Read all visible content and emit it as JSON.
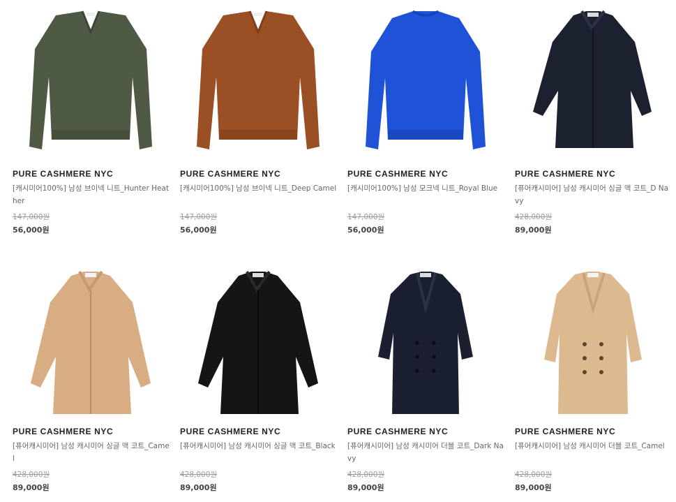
{
  "products": [
    {
      "brand": "PURE CASHMERE NYC",
      "name": "[캐시미어100%] 남성 브이넥 니트_Hunter Heather",
      "original_price": "147,000원",
      "price": "56,000원",
      "image": "vneck-sweater-icon",
      "color": "#4f5a45"
    },
    {
      "brand": "PURE CASHMERE NYC",
      "name": "[캐시미어100%] 남성 브이넥 니트_Deep Camel",
      "original_price": "147,000원",
      "price": "56,000원",
      "image": "vneck-sweater-icon",
      "color": "#9a4f24"
    },
    {
      "brand": "PURE CASHMERE NYC",
      "name": "[캐시미어100%] 남성 모크넥 니트_Royal Blue",
      "original_price": "147,000원",
      "price": "56,000원",
      "image": "mockneck-sweater-icon",
      "color": "#1f52d6"
    },
    {
      "brand": "PURE CASHMERE NYC",
      "name": "[퓨어캐시미어] 남성 캐시미어 싱글 맥 코트_D Navy",
      "original_price": "428,000원",
      "price": "89,000원",
      "image": "single-mac-coat-icon",
      "color": "#1c2130"
    },
    {
      "brand": "PURE CASHMERE NYC",
      "name": "[퓨어캐시미어] 남성 캐시미어 싱글 맥 코트_Camel",
      "original_price": "428,000원",
      "price": "89,000원",
      "image": "single-mac-coat-icon",
      "color": "#d8ad83"
    },
    {
      "brand": "PURE CASHMERE NYC",
      "name": "[퓨어캐시미어] 남성 캐시미어 싱글 맥 코트_Black",
      "original_price": "428,000원",
      "price": "89,000원",
      "image": "single-mac-coat-icon",
      "color": "#151515"
    },
    {
      "brand": "PURE CASHMERE NYC",
      "name": "[퓨어캐시미어] 남성 캐시미어 더블 코트_Dark Navy",
      "original_price": "428,000원",
      "price": "89,000원",
      "image": "double-coat-icon",
      "color": "#1b2030"
    },
    {
      "brand": "PURE CASHMERE NYC",
      "name": "[퓨어캐시미어] 남성 캐시미어 더블 코트_Camel",
      "original_price": "428,000원",
      "price": "89,000원",
      "image": "double-coat-icon",
      "color": "#ddb98f"
    }
  ]
}
